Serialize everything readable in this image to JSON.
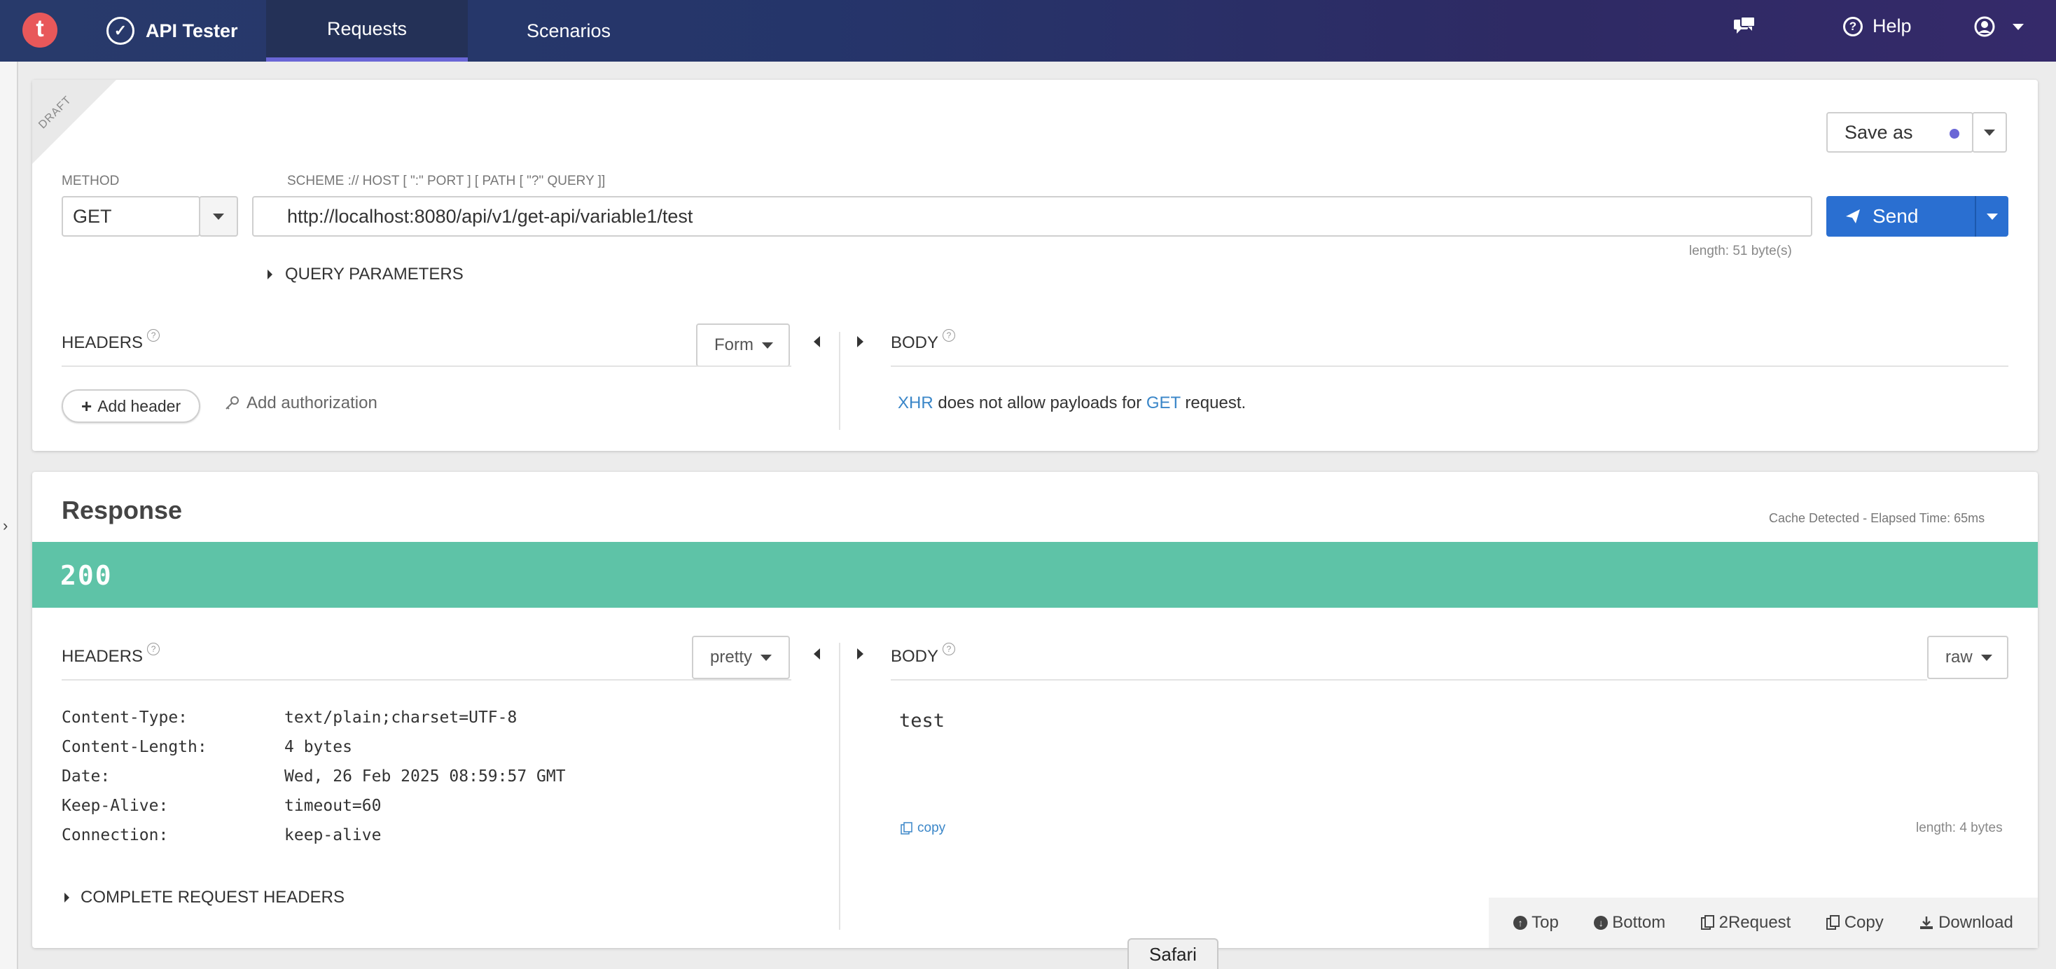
{
  "topbar": {
    "logo_letter": "t",
    "app_name": "API Tester",
    "tabs": [
      {
        "label": "Requests"
      },
      {
        "label": "Scenarios"
      }
    ],
    "help_label": "Help"
  },
  "request": {
    "draft_label": "DRAFT",
    "save_as_label": "Save as",
    "method_label": "METHOD",
    "method_value": "GET",
    "url_hint": "SCHEME :// HOST [ \":\" PORT ] [ PATH [ \"?\" QUERY ]]",
    "url_value": "http://localhost:8080/api/v1/get-api/variable1/test",
    "length_label": "length: 51 byte(s)",
    "send_label": "Send",
    "query_params_label": "QUERY PARAMETERS",
    "headers_label": "HEADERS",
    "form_label": "Form",
    "add_header_label": "Add header",
    "add_auth_label": "Add authorization",
    "body_label": "BODY",
    "body_note": {
      "xhr": "XHR",
      "middle": " does not allow payloads for ",
      "get": "GET",
      "end": " request."
    }
  },
  "response": {
    "title": "Response",
    "cache_info": "Cache Detected - Elapsed Time: 65ms",
    "status_code": "200",
    "headers_label": "HEADERS",
    "pretty_label": "pretty",
    "body_label": "BODY",
    "raw_label": "raw",
    "headers": [
      {
        "key": "Content-Type:",
        "value": "text/plain;charset=UTF-8"
      },
      {
        "key": "Content-Length:",
        "value": "4 bytes"
      },
      {
        "key": "Date:",
        "value": "Wed, 26 Feb 2025 08:59:57 GMT"
      },
      {
        "key": "Keep-Alive:",
        "value": "timeout=60"
      },
      {
        "key": "Connection:",
        "value": "keep-alive"
      }
    ],
    "body_text": "test",
    "copy_label": "copy",
    "length_label": "length: 4 bytes",
    "complete_headers_label": "COMPLETE REQUEST HEADERS",
    "footer_actions": [
      {
        "label": "Top"
      },
      {
        "label": "Bottom"
      },
      {
        "label": "2Request"
      },
      {
        "label": "Copy"
      },
      {
        "label": "Download"
      }
    ]
  },
  "tooltip": {
    "label": "Safari"
  },
  "colors": {
    "status_ok": "#5ec3a7",
    "primary": "#2a6fd1",
    "accent": "#6a66d6"
  }
}
